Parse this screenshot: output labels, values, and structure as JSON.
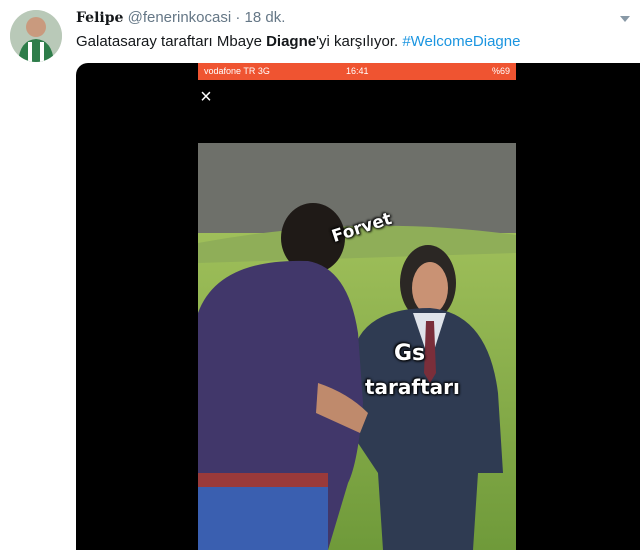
{
  "tweet": {
    "display_name": "Felipe",
    "handle": "@fenerinkocasi",
    "separator": "·",
    "time": "18 dk.",
    "text_before": "Galatasaray taraftarı Mbaye ",
    "text_bold": "Diagne",
    "text_after": "'yi karşılıyor. ",
    "hashtag": "#WelcomeDiagne"
  },
  "media": {
    "status_left": "vodafone TR  3G",
    "status_time": "16:41",
    "status_right": "%69",
    "close_icon": "×",
    "caption_top": "Forvet",
    "caption_mid": "Gs",
    "caption_bottom": "taraftarı"
  },
  "colors": {
    "link": "#1b95e0",
    "status_bar": "#ef5431",
    "media_bg": "#000000"
  }
}
